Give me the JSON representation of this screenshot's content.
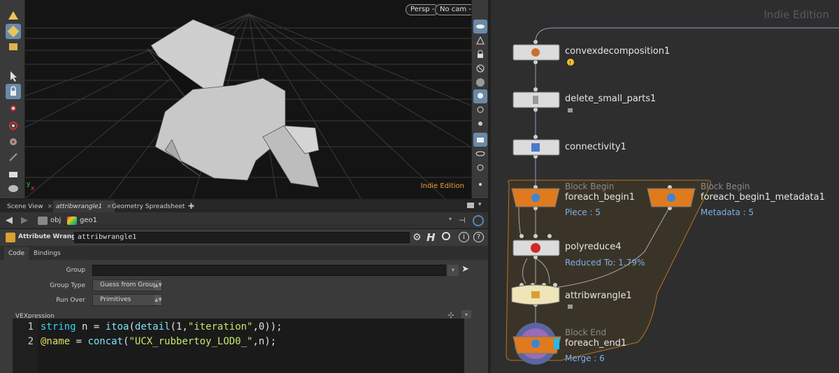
{
  "viewport": {
    "camera_persp": "Persp -",
    "camera_nocam": "No cam -",
    "edition": "Indie Edition"
  },
  "tabs": [
    {
      "label": "Scene View"
    },
    {
      "label": "attribwrangle1"
    },
    {
      "label": "Geometry Spreadsheet"
    }
  ],
  "tab_add": "+",
  "path": {
    "obj": "obj",
    "geo": "geo1"
  },
  "node": {
    "type_label": "Attribute Wrangle",
    "name": "attribwrangle1"
  },
  "subtabs": [
    {
      "label": "Code"
    },
    {
      "label": "Bindings"
    }
  ],
  "parms": {
    "group_label": "Group",
    "group_value": "",
    "group_type_label": "Group Type",
    "group_type_value": "Guess from Group",
    "run_over_label": "Run Over",
    "run_over_value": "Primitives",
    "vex_label": "VEXpression"
  },
  "code": {
    "line_numbers": [
      "1",
      "2"
    ],
    "line1": {
      "t1": "string",
      "t2": " n = ",
      "t3": "itoa",
      "t4": "(",
      "t5": "detail",
      "t6": "(1,",
      "t7": "\"iteration\"",
      "t8": ",0));"
    },
    "line2": {
      "t1": "@name",
      "t2": " = ",
      "t3": "concat",
      "t4": "(",
      "t5": "\"UCX_rubbertoy_LOD0_\"",
      "t6": ",n);"
    }
  },
  "network": {
    "edition": "Indie Edition",
    "nodes": [
      {
        "name": "convexdecomposition1"
      },
      {
        "name": "delete_small_parts1"
      },
      {
        "name": "connectivity1"
      },
      {
        "name": "foreach_begin1",
        "block": "Block Begin",
        "info": "Piece : 5"
      },
      {
        "name": "foreach_begin1_metadata1",
        "block": "Block Begin",
        "info": "Metadata : 5"
      },
      {
        "name": "polyreduce4",
        "info": "Reduced To: 1.79%"
      },
      {
        "name": "attribwrangle1"
      },
      {
        "name": "foreach_end1",
        "block": "Block End",
        "info": "Merge : 6"
      }
    ]
  },
  "colors": {
    "accent": "#e07a1e",
    "info_blue": "#7db0e8",
    "edition_orange": "#f0a030"
  },
  "icons": [
    "sphere-tool-icon",
    "select-arrow-icon",
    "lock-icon",
    "gear-icon",
    "help-icon",
    "search-icon",
    "home-icon",
    "warning-icon"
  ]
}
